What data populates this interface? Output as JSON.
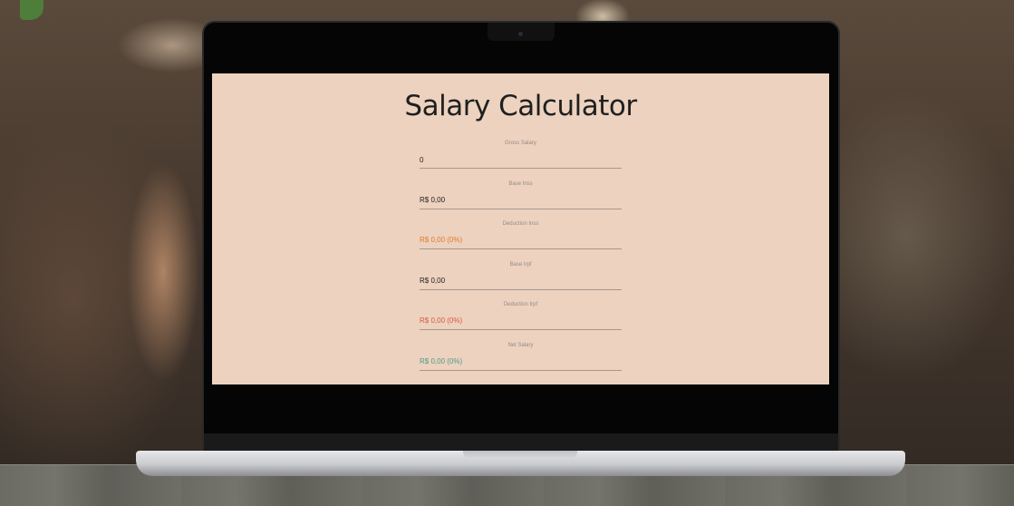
{
  "app": {
    "title": "Salary Calculator"
  },
  "fields": [
    {
      "label": "Gross Salary",
      "value": "0",
      "type": "input"
    },
    {
      "label": "Base Inss",
      "value": "R$ 0,00",
      "type": "output"
    },
    {
      "label": "Deduction Inss",
      "value": "R$ 0,00 (0%)",
      "type": "output"
    },
    {
      "label": "Base Irpf",
      "value": "R$ 0,00",
      "type": "output"
    },
    {
      "label": "Deduction Irpf",
      "value": "R$ 0,00 (0%)",
      "type": "output"
    },
    {
      "label": "Net Salary",
      "value": "R$ 0,00 (0%)",
      "type": "output"
    }
  ],
  "colors": {
    "screen_background": "#ecd2bf",
    "deduction_inss": "#e07b2c",
    "deduction_irpf": "#d65b47",
    "net_salary": "#4f9a8a"
  }
}
